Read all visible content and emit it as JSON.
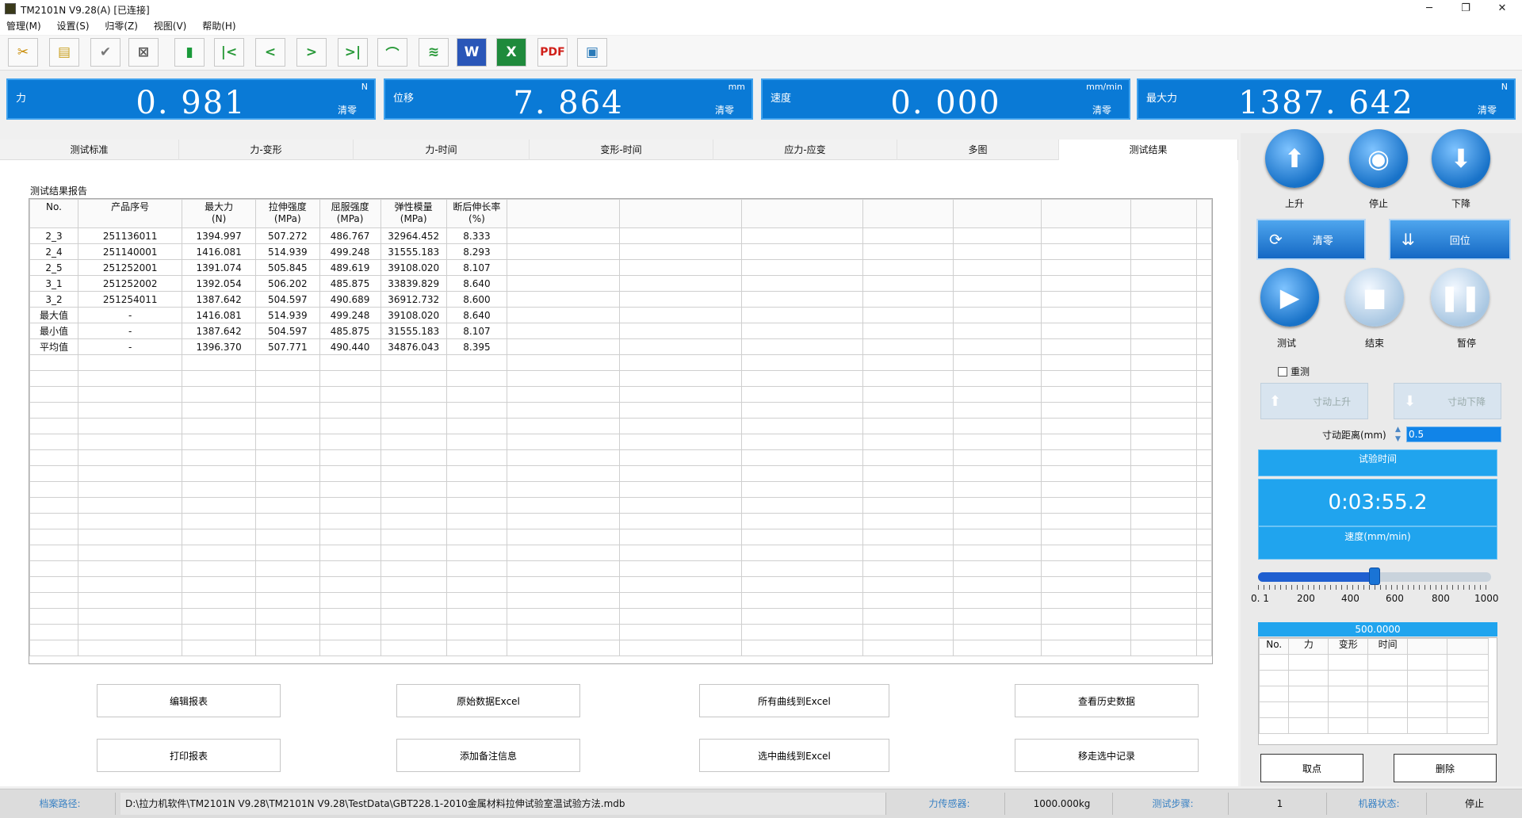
{
  "window": {
    "title": "TM2101N V9.28(A)  [已连接]",
    "min": "─",
    "max": "❐",
    "close": "✕"
  },
  "menu": [
    "管理(M)",
    "设置(S)",
    "归零(Z)",
    "视图(V)",
    "帮助(H)"
  ],
  "toolbar": {
    "icons": [
      "tools-icon",
      "open-folder-icon",
      "print-preview-icon",
      "exit-icon",
      "delete-icon",
      "first-icon",
      "prev-icon",
      "next-icon",
      "last-icon",
      "curve-icon",
      "multi-curve-icon",
      "word-icon",
      "excel-icon",
      "pdf-icon",
      "monitor-icon"
    ],
    "pdf": "PDF",
    "word": "W",
    "excel": "X"
  },
  "readouts": [
    {
      "label": "力",
      "unit": "N",
      "value": "0. 981",
      "zero": "清零"
    },
    {
      "label": "位移",
      "unit": "mm",
      "value": "7. 864",
      "zero": "清零"
    },
    {
      "label": "速度",
      "unit": "mm/min",
      "value": "0. 000",
      "zero": "清零"
    },
    {
      "label": "最大力",
      "unit": "N",
      "value": "1387. 642",
      "zero": "清零"
    }
  ],
  "tabs": [
    "测试标准",
    "力-变形",
    "力-时间",
    "变形-时间",
    "应力-应变",
    "多图",
    "测试结果"
  ],
  "active_tab": "测试结果",
  "report": {
    "title": "测试结果报告",
    "headers": [
      "No.",
      "产品序号",
      "最大力\n(N)",
      "拉伸强度\n(MPa)",
      "屈服强度\n(MPa)",
      "弹性模量\n(MPa)",
      "断后伸长率\n(%)"
    ],
    "rows": [
      [
        "2_3",
        "251136011",
        "1394.997",
        "507.272",
        "486.767",
        "32964.452",
        "8.333"
      ],
      [
        "2_4",
        "251140001",
        "1416.081",
        "514.939",
        "499.248",
        "31555.183",
        "8.293"
      ],
      [
        "2_5",
        "251252001",
        "1391.074",
        "505.845",
        "489.619",
        "39108.020",
        "8.107"
      ],
      [
        "3_1",
        "251252002",
        "1392.054",
        "506.202",
        "485.875",
        "33839.829",
        "8.640"
      ],
      [
        "3_2",
        "251254011",
        "1387.642",
        "504.597",
        "490.689",
        "36912.732",
        "8.600"
      ],
      [
        "最大值",
        "-",
        "1416.081",
        "514.939",
        "499.248",
        "39108.020",
        "8.640"
      ],
      [
        "最小值",
        "-",
        "1387.642",
        "504.597",
        "485.875",
        "31555.183",
        "8.107"
      ],
      [
        "平均值",
        "-",
        "1396.370",
        "507.771",
        "490.440",
        "34876.043",
        "8.395"
      ]
    ]
  },
  "buttons": {
    "edit_report": "编辑报表",
    "raw_excel": "原始数据Excel",
    "all_curves_excel": "所有曲线到Excel",
    "history": "查看历史数据",
    "print_report": "打印报表",
    "add_note": "添加备注信息",
    "selected_curves_excel": "选中曲线到Excel",
    "remove_selected": "移走选中记录"
  },
  "control": {
    "up": "上升",
    "stop": "停止",
    "down": "下降",
    "zero": "清零",
    "home": "回位",
    "test": "测试",
    "end": "结束",
    "pause": "暂停",
    "retest": "重测",
    "jog_up": "寸动上升",
    "jog_down": "寸动下降",
    "jog_distance_label": "寸动距离(mm)",
    "jog_distance_value": "0.5",
    "test_time_label": "试验时间",
    "test_time_value": "0:03:55.2",
    "speed_label": "速度(mm/min)",
    "slider_ticks": [
      "0. 1",
      "200",
      "400",
      "600",
      "800",
      "1000"
    ],
    "slider_fraction": 0.5,
    "points_value": "500.0000",
    "points_headers": [
      "No.",
      "力",
      "变形",
      "时间",
      "",
      ""
    ],
    "take_point": "取点",
    "delete": "删除"
  },
  "status": {
    "path_label": "档案路径:",
    "path_value": "D:\\拉力机软件\\TM2101N V9.28\\TM2101N V9.28\\TestData\\GBT228.1-2010金属材料拉伸试验室温试验方法.mdb",
    "sensor_label": "力传感器:",
    "sensor_value": "1000.000kg",
    "step_label": "测试步骤:",
    "step_value": "1",
    "machine_label": "机器状态:",
    "machine_value": "停止"
  },
  "colors": {
    "accent": "#0a7ad6",
    "panel": "#20a4ee"
  }
}
